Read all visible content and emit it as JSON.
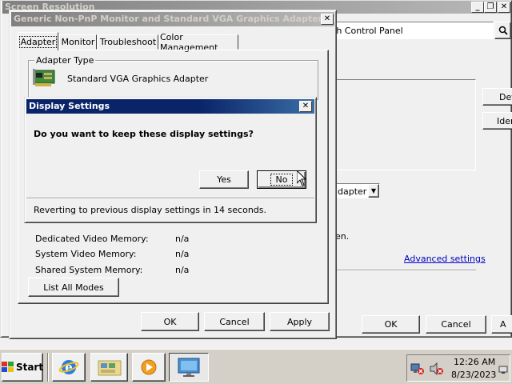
{
  "back_window": {
    "title": "Screen Resolution",
    "address_text": "rch Control Panel",
    "detect_label": "Det",
    "identify_label": "Ider",
    "dropdown_text": "dapter",
    "partial_text": "en.",
    "advanced_settings_link": "Advanced settings",
    "ok_label": "OK",
    "cancel_label": "Cancel",
    "apply_label": "A"
  },
  "props_dialog": {
    "title": "Generic Non-PnP Monitor and Standard VGA Graphics Adapter Pro...",
    "tabs": [
      {
        "label": "Adapter"
      },
      {
        "label": "Monitor"
      },
      {
        "label": "Troubleshoot"
      },
      {
        "label": "Color Management"
      }
    ],
    "adapter_type_group": "Adapter Type",
    "adapter_name": "Standard VGA Graphics Adapter",
    "memory": [
      {
        "label": "Dedicated Video Memory:",
        "value": "n/a"
      },
      {
        "label": "System Video Memory:",
        "value": "n/a"
      },
      {
        "label": "Shared System Memory:",
        "value": "n/a"
      }
    ],
    "list_all_modes_label": "List All Modes",
    "ok_label": "OK",
    "cancel_label": "Cancel",
    "apply_label": "Apply"
  },
  "display_settings": {
    "title": "Display Settings",
    "question": "Do you want to keep these display settings?",
    "yes_label": "Yes",
    "no_label": "No",
    "countdown": "Reverting to previous display settings in 14 seconds."
  },
  "taskbar": {
    "start_label": "Start",
    "time": "12:26 AM",
    "date": "8/23/2023"
  }
}
